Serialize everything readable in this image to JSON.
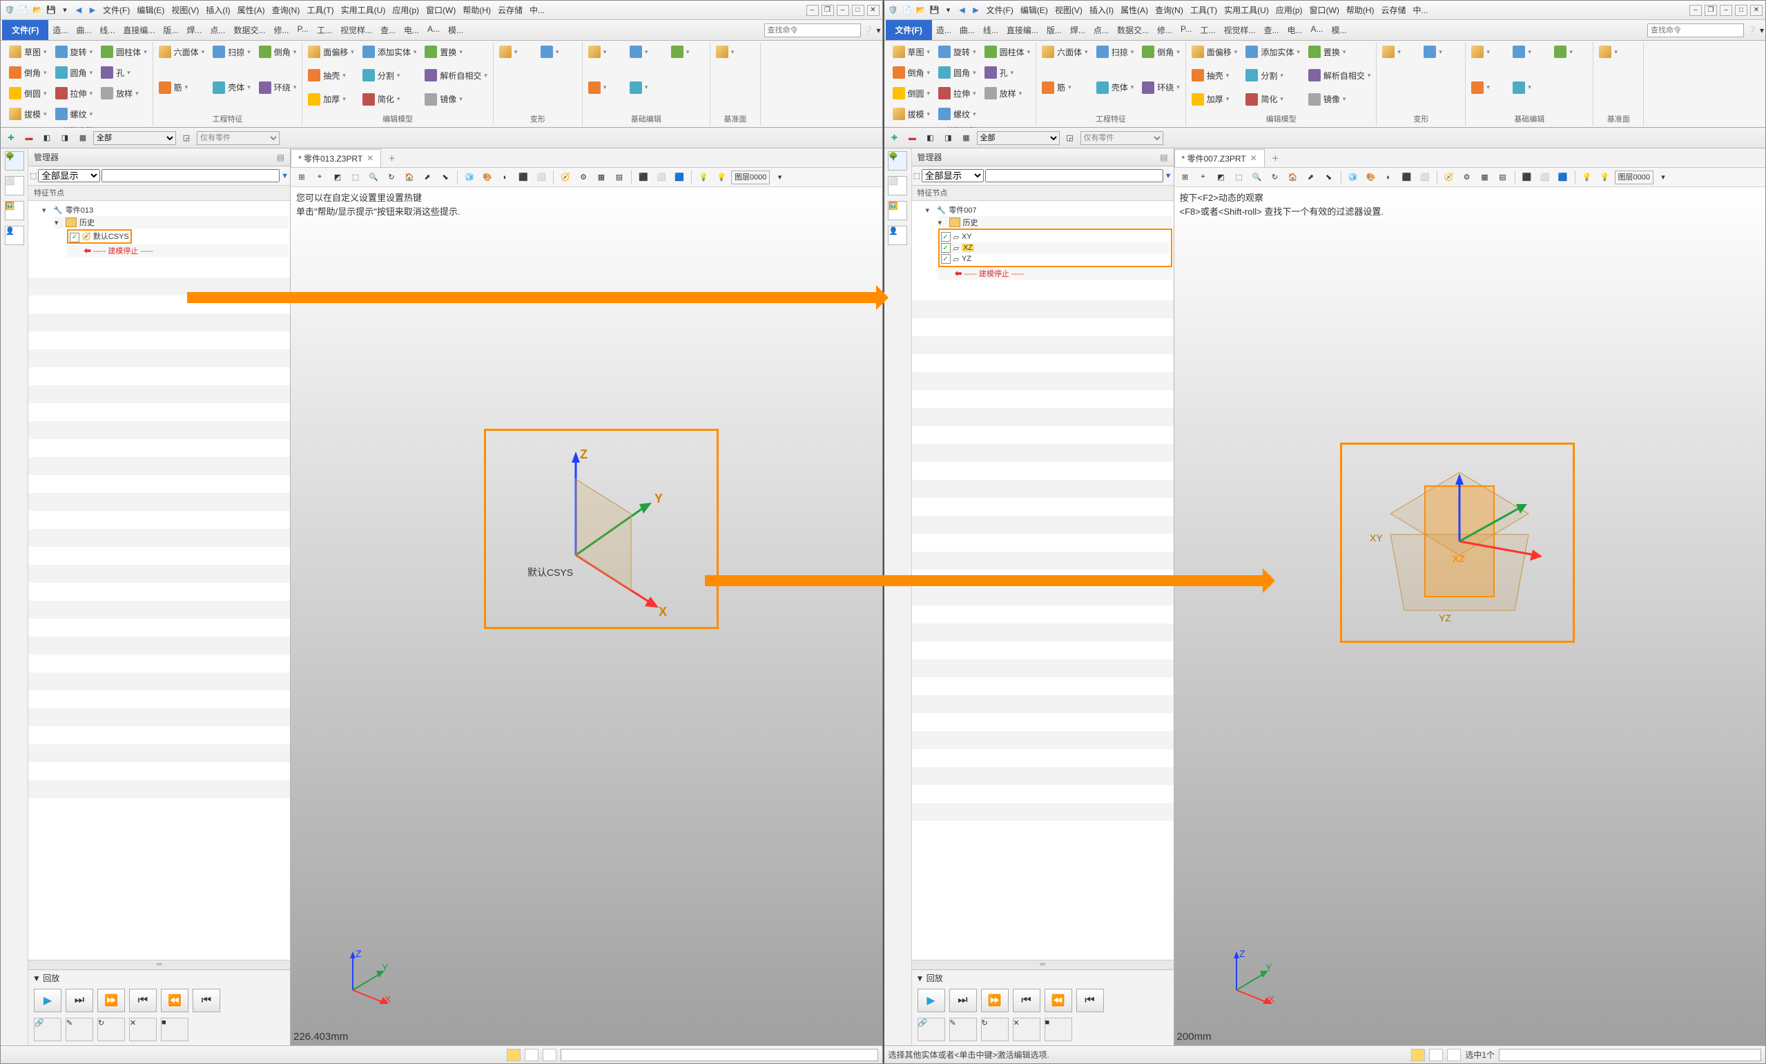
{
  "menus": [
    "文件(F)",
    "编辑(E)",
    "视图(V)",
    "插入(I)",
    "属性(A)",
    "查询(N)",
    "工具(T)",
    "实用工具(U)",
    "应用(p)",
    "窗口(W)",
    "帮助(H)",
    "云存储",
    "中..."
  ],
  "file_tab": "文件(F)",
  "ribbon_tabs": [
    "造...",
    "曲...",
    "线...",
    "直接编...",
    "版...",
    "焊...",
    "点...",
    "数据交...",
    "修...",
    "P...",
    "工...",
    "视觉样...",
    "查...",
    "电...",
    "A...",
    "模..."
  ],
  "search_placeholder": "查找命令",
  "ribbon_groups": [
    {
      "label": "基础造型",
      "items": [
        "草图",
        "旋转",
        "圆柱体",
        "倒角",
        "圆角",
        "孔",
        "倒圆",
        "拉伸",
        "放样",
        "拔模",
        "螺纹"
      ]
    },
    {
      "label": "工程特征",
      "items": [
        "六面体",
        "扫掠",
        "倒角",
        "筋",
        "壳体",
        "环绕"
      ]
    },
    {
      "label": "编辑模型",
      "items": [
        "面偏移",
        "添加实体",
        "置换",
        "抽壳",
        "分割",
        "解析自相交",
        "加厚",
        "简化",
        "镜像"
      ]
    },
    {
      "label": "变形",
      "items": [
        "",
        ""
      ]
    },
    {
      "label": "基础编辑",
      "items": [
        "",
        "",
        "",
        "",
        ""
      ]
    },
    {
      "label": "基准面",
      "items": [
        ""
      ]
    }
  ],
  "toolbar_all": "全部",
  "toolbar_parts_only": "仅有零件",
  "left": {
    "manager_title": "管理器",
    "show_all": "全部显示",
    "sub_title": "特征节点",
    "root": "零件013",
    "history": "历史",
    "csys": "默认CSYS",
    "stop": "----- 建模停止 -----",
    "tab": "* 零件013.Z3PRT",
    "hint1": "您可以在自定义设置里设置热键",
    "hint2": "单击\"帮助/显示提示\"按钮来取消这些提示.",
    "measure": "226.403mm",
    "layer_prefix": "图层",
    "layer_value": "0000",
    "playback_title": "▼ 回放",
    "status": "",
    "csys_label": "默认CSYS"
  },
  "right": {
    "manager_title": "管理器",
    "show_all": "全部显示",
    "sub_title": "特征节点",
    "root": "零件007",
    "history": "历史",
    "planes": [
      "XY",
      "XZ",
      "YZ"
    ],
    "selected_plane": "XZ",
    "stop": "----- 建模停止 -----",
    "tab": "* 零件007.Z3PRT",
    "hint1": "按下<F2>动态的观察",
    "hint2": "<F8>或者<Shift-roll> 查找下一个有效的过滤器设置.",
    "measure": "200mm",
    "layer_prefix": "图层",
    "layer_value": "0000",
    "playback_title": "▼ 回放",
    "status": "选择其他实体或者<单击中键>激活编辑选项.",
    "status_right": "选中1个"
  },
  "axes": {
    "x": "X",
    "y": "Y",
    "z": "Z",
    "xy": "XY",
    "xz": "XZ",
    "yz": "YZ"
  }
}
